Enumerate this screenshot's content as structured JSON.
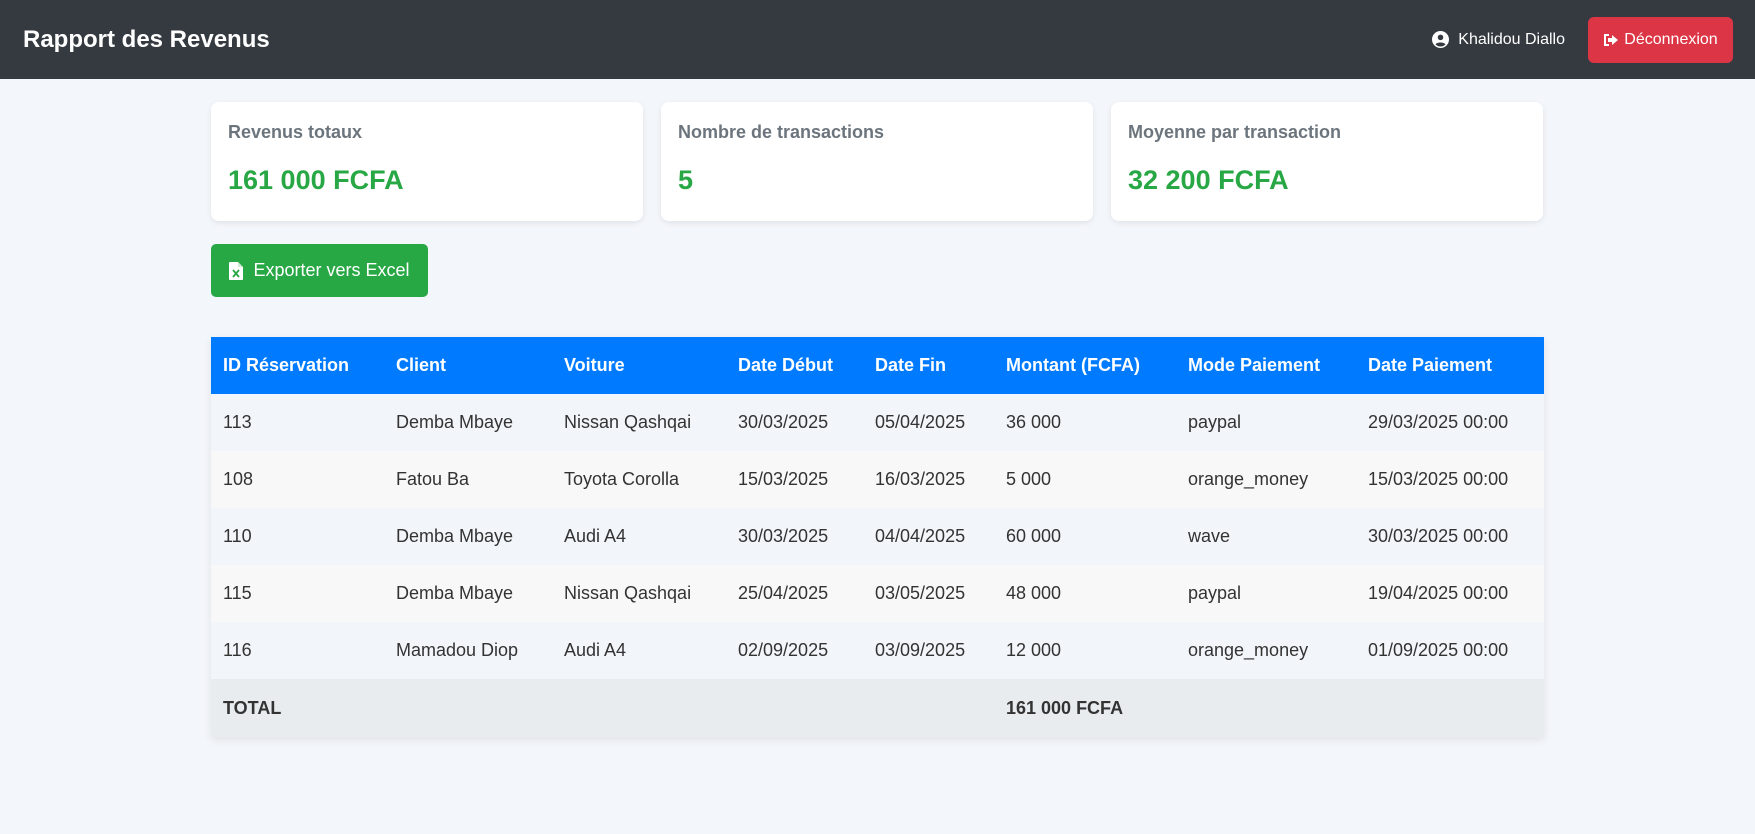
{
  "header": {
    "title": "Rapport des Revenus",
    "user_name": "Khalidou Diallo",
    "logout_label": "Déconnexion"
  },
  "stats": [
    {
      "label": "Revenus totaux",
      "value": "161 000 FCFA"
    },
    {
      "label": "Nombre de transactions",
      "value": "5"
    },
    {
      "label": "Moyenne par transaction",
      "value": "32 200 FCFA"
    }
  ],
  "export_label": "Exporter vers Excel",
  "table": {
    "columns": [
      "ID Réservation",
      "Client",
      "Voiture",
      "Date Début",
      "Date Fin",
      "Montant (FCFA)",
      "Mode Paiement",
      "Date Paiement"
    ],
    "rows": [
      [
        "113",
        "Demba Mbaye",
        "Nissan Qashqai",
        "30/03/2025",
        "05/04/2025",
        "36 000",
        "paypal",
        "29/03/2025 00:00"
      ],
      [
        "108",
        "Fatou Ba",
        "Toyota Corolla",
        "15/03/2025",
        "16/03/2025",
        "5 000",
        "orange_money",
        "15/03/2025 00:00"
      ],
      [
        "110",
        "Demba Mbaye",
        "Audi A4",
        "30/03/2025",
        "04/04/2025",
        "60 000",
        "wave",
        "30/03/2025 00:00"
      ],
      [
        "115",
        "Demba Mbaye",
        "Nissan Qashqai",
        "25/04/2025",
        "03/05/2025",
        "48 000",
        "paypal",
        "19/04/2025 00:00"
      ],
      [
        "116",
        "Mamadou Diop",
        "Audi A4",
        "02/09/2025",
        "03/09/2025",
        "12 000",
        "orange_money",
        "01/09/2025 00:00"
      ]
    ],
    "total_label": "TOTAL",
    "total_value": "161 000 FCFA"
  },
  "colors": {
    "topbar": "#343a40",
    "logout": "#dc3545",
    "accent_green": "#28a745",
    "table_header": "#007bff"
  },
  "icons": {
    "user": "user-circle-icon",
    "logout": "sign-out-icon",
    "export": "file-excel-icon"
  }
}
